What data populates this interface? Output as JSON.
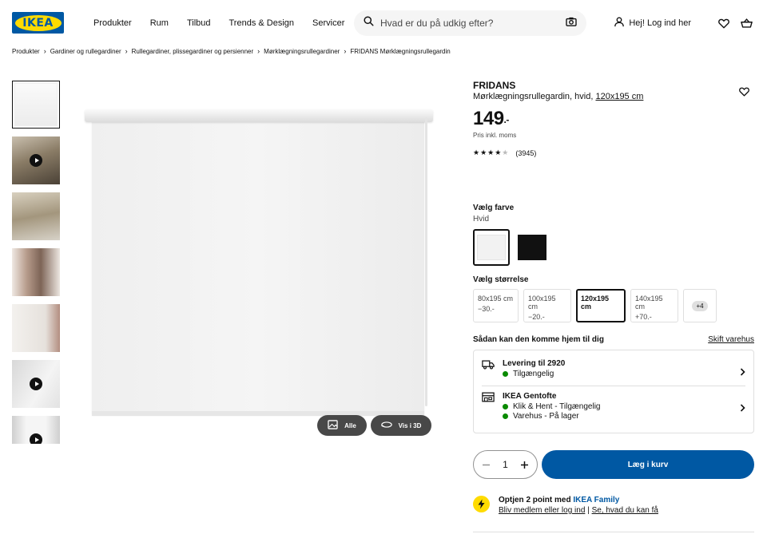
{
  "header": {
    "logo_text": "IKEA",
    "nav": [
      "Produkter",
      "Rum",
      "Tilbud",
      "Trends & Design",
      "Servicer"
    ],
    "search_placeholder": "Hvad er du på udkig efter?",
    "login_label": "Hej! Log ind her"
  },
  "breadcrumb": [
    "Produkter",
    "Gardiner og rullegardiner",
    "Rullegardiner, plissegardiner og persienner",
    "Mørklægningsrullegardiner",
    "FRIDANS Mørklægningsrullegardin"
  ],
  "gallery": {
    "all_label": "Alle",
    "view3d_label": "Vis i 3D"
  },
  "product": {
    "name": "FRIDANS",
    "description": "Mørklægningsrullegardin, hvid,",
    "size_link": "120x195 cm",
    "price": "149",
    "price_suffix": ".-",
    "price_note": "Pris inkl. moms",
    "rating_stars": 4,
    "rating_count": "(3945)"
  },
  "color": {
    "title": "Vælg farve",
    "selected": "Hvid",
    "swatches": [
      "#f2f2f2",
      "#111111"
    ]
  },
  "size": {
    "title": "Vælg størrelse",
    "options": [
      {
        "label": "80x195 cm",
        "delta": "−30.-"
      },
      {
        "label": "100x195 cm",
        "delta": "−20.-"
      },
      {
        "label": "120x195 cm",
        "delta": ""
      },
      {
        "label": "140x195 cm",
        "delta": "+70.-"
      }
    ],
    "more": "+4"
  },
  "delivery": {
    "title": "Sådan kan den komme hjem til dig",
    "change_store": "Skift varehus",
    "ship_title": "Levering til 2920",
    "ship_status": "Tilgængelig",
    "store_title": "IKEA Gentofte",
    "store_click": "Klik & Hent - Tilgængelig",
    "store_stock": "Varehus - På lager"
  },
  "cart": {
    "quantity": "1",
    "add_label": "Læg i kurv"
  },
  "family": {
    "prefix": "Optjen 2 point med",
    "brand": "IKEA Family",
    "join_link": "Bliv medlem eller log ind",
    "divider": "|",
    "info_link": "Se, hvad du kan få"
  },
  "colors": {
    "ikea_blue": "#0058a3",
    "ikea_yellow": "#ffdb00",
    "available_green": "#0a8a00"
  }
}
